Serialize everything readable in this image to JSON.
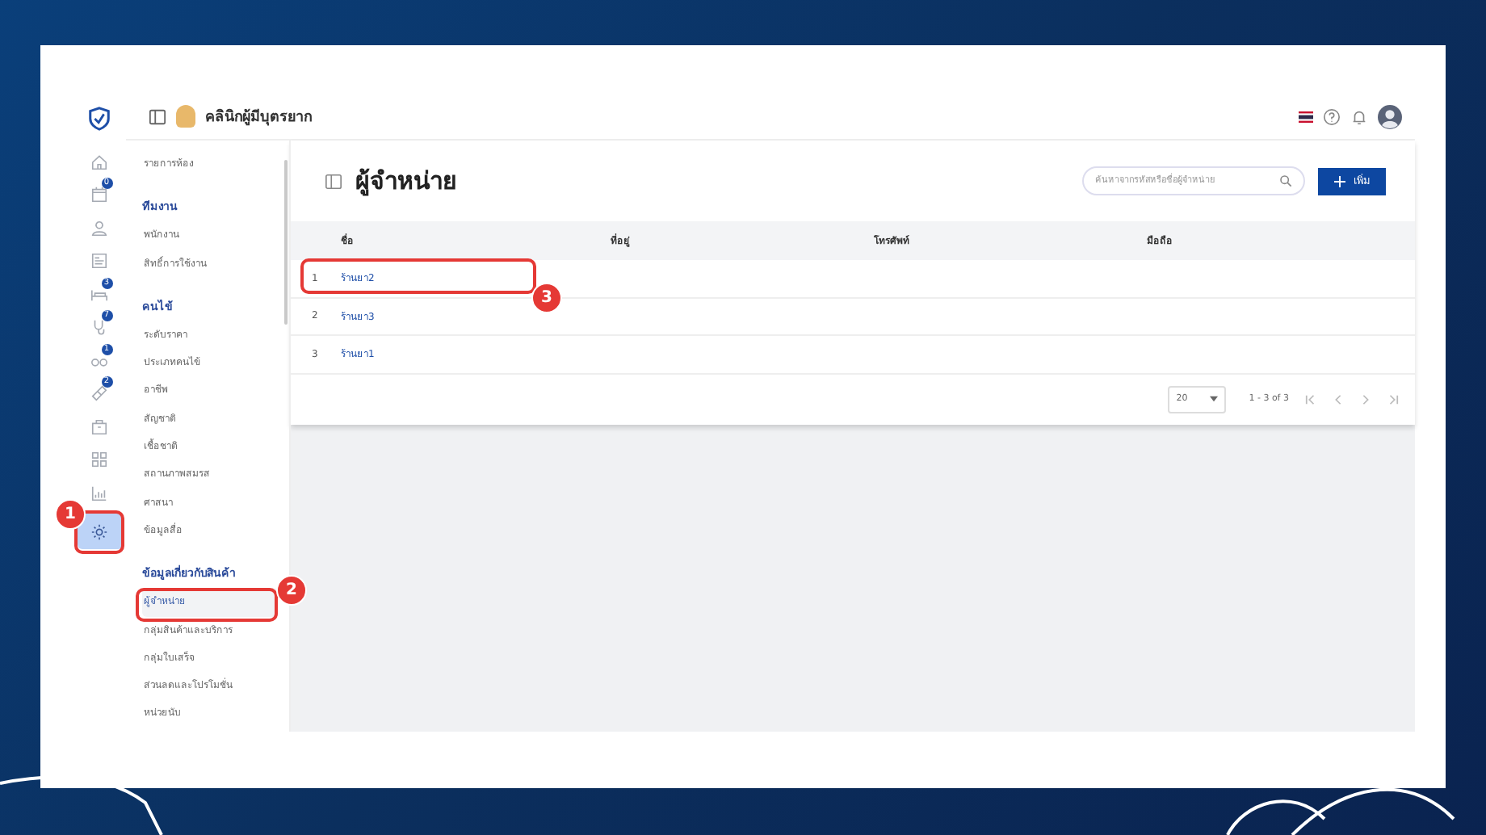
{
  "header": {
    "clinic_name": "คลินิกผู้มีบุตรยาก"
  },
  "rail": [
    {
      "kind": "home",
      "selected": false
    },
    {
      "kind": "calendar",
      "badge": "0",
      "selected": false
    },
    {
      "kind": "person",
      "selected": false
    },
    {
      "kind": "card",
      "selected": false
    },
    {
      "kind": "bed",
      "badge": "3",
      "selected": false
    },
    {
      "kind": "stethoscope",
      "badge": "7",
      "selected": false
    },
    {
      "kind": "glasses",
      "badge": "1",
      "selected": false
    },
    {
      "kind": "pill",
      "badge": "2",
      "selected": false
    },
    {
      "kind": "box",
      "selected": false
    },
    {
      "kind": "grid",
      "selected": false
    },
    {
      "kind": "chart",
      "selected": false
    },
    {
      "kind": "gear",
      "selected": true
    }
  ],
  "menu": [
    {
      "kind": "item",
      "label": "รายการห้อง",
      "selected": false
    },
    {
      "kind": "heading",
      "label": "ทีมงาน"
    },
    {
      "kind": "item",
      "label": "พนักงาน",
      "selected": false
    },
    {
      "kind": "item",
      "label": "สิทธิ์การใช้งาน",
      "selected": false
    },
    {
      "kind": "heading",
      "label": "คนไข้"
    },
    {
      "kind": "item",
      "label": "ระดับราคา",
      "selected": false
    },
    {
      "kind": "item",
      "label": "ประเภทคนไข้",
      "selected": false
    },
    {
      "kind": "item",
      "label": "อาชีพ",
      "selected": false
    },
    {
      "kind": "item",
      "label": "สัญชาติ",
      "selected": false
    },
    {
      "kind": "item",
      "label": "เชื้อชาติ",
      "selected": false
    },
    {
      "kind": "item",
      "label": "สถานภาพสมรส",
      "selected": false
    },
    {
      "kind": "item",
      "label": "ศาสนา",
      "selected": false
    },
    {
      "kind": "item",
      "label": "ข้อมูลสื่อ",
      "selected": false
    },
    {
      "kind": "heading",
      "label": "ข้อมูลเกี่ยวกับสินค้า"
    },
    {
      "kind": "item",
      "label": "ผู้จำหน่าย",
      "selected": true
    },
    {
      "kind": "item",
      "label": "กลุ่มสินค้าและบริการ",
      "selected": false
    },
    {
      "kind": "item",
      "label": "กลุ่มใบเสร็จ",
      "selected": false
    },
    {
      "kind": "item",
      "label": "ส่วนลดและโปรโมชั่น",
      "selected": false
    },
    {
      "kind": "item",
      "label": "หน่วยนับ",
      "selected": false
    }
  ],
  "page": {
    "title": "ผู้จำหน่าย",
    "search": {
      "placeholder": "ค้นหาจากรหัสหรือชื่อผู้จำหน่าย"
    },
    "add_button": "เพิ่ม"
  },
  "table": {
    "columns": [
      "ชื่อ",
      "ที่อยู่",
      "โทรศัพท์",
      "มือถือ"
    ],
    "rows": [
      {
        "index": "1",
        "name": "ร้านยา2"
      },
      {
        "index": "2",
        "name": "ร้านยา3"
      },
      {
        "index": "3",
        "name": "ร้านยา1"
      }
    ]
  },
  "pagination": {
    "page_size": "20",
    "range": "1 - 3 of 3"
  },
  "annotations": [
    {
      "number": "1"
    },
    {
      "number": "2"
    },
    {
      "number": "3"
    }
  ]
}
